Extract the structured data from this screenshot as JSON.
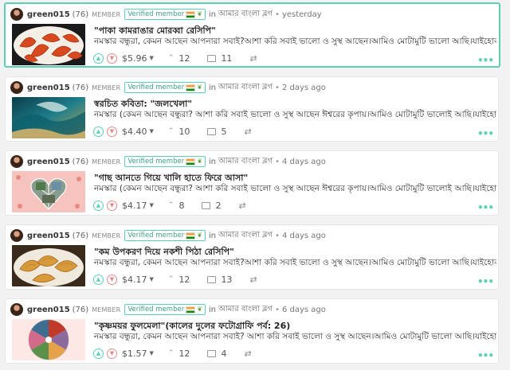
{
  "posts": [
    {
      "author": "green015",
      "reputation": "(76)",
      "role": "MEMBER",
      "badge": "Verified member",
      "in": "in",
      "community": "আমার বাংলা ব্লগ",
      "time": "yesterday",
      "title": "\"পাকা কামরাঙার মোরব্বা রেসিপি\"",
      "excerpt": "নমস্কার বন্ধুরা, কেমন আছেন আপনারা সবাই?আশা করি সবাই ভালো ও সুস্থ আছেন।আমিও মোটামুটি ভালো আছি।যাইহোক আজ চলে আসলাম",
      "payout": "$5.96",
      "votes": "12",
      "comments": "11"
    },
    {
      "author": "green015",
      "reputation": "(76)",
      "role": "MEMBER",
      "badge": "Verified member",
      "in": "in",
      "community": "আমার বাংলা ব্লগ",
      "time": "2 days ago",
      "title": "স্বরচিত কবিতা: \"জলখেলা\"",
      "excerpt": "নমস্কার (কেমন আছেন বন্ধুরা? আশা করি সবাই ভালো ও সুস্থ আছেন ঈশ্বরের কৃপায়।আমিও মোটামুটি ভালোই আছি।যাইহোক আজ চলে",
      "payout": "$4.40",
      "votes": "10",
      "comments": "5"
    },
    {
      "author": "green015",
      "reputation": "(76)",
      "role": "MEMBER",
      "badge": "Verified member",
      "in": "in",
      "community": "আমার বাংলা ব্লগ",
      "time": "4 days ago",
      "title": "\"গাছ আনতে গিয়ে খালি হাতে ফিরে আসা\"",
      "excerpt": "নমস্কার (কেমন আছেন বন্ধুরা? আশা করি সবাই ভালো ও সুস্থ আছেন ঈশ্বরের কৃপায়।আমিও মোটামুটি ভালোই আছি।যাইহোক আজ চলে",
      "payout": "$4.17",
      "votes": "8",
      "comments": "2"
    },
    {
      "author": "green015",
      "reputation": "(76)",
      "role": "MEMBER",
      "badge": "Verified member",
      "in": "in",
      "community": "আমার বাংলা ব্লগ",
      "time": "4 days ago",
      "title": "\"কম উপকরণ দিয়ে নকশী পিঠা রেসিপি\"",
      "excerpt": "নমস্কার বন্ধুরা, কেমন আছেন আপনারা সবাই?আশা করি সবাই ভালো ও সুস্থ আছেন।আমিও মোটামুটি ভালো আছি।যাইহোক আজ চলে আসলাম",
      "payout": "$4.17",
      "votes": "12",
      "comments": "13"
    },
    {
      "author": "green015",
      "reputation": "(76)",
      "role": "MEMBER",
      "badge": "Verified member",
      "in": "in",
      "community": "আমার বাংলা ব্লগ",
      "time": "6 days ago",
      "title": "\"কৃষ্ণময়র ফুলমেলা\"(কালের দুলের ফটোগ্রাফি পর্ব: 26)",
      "excerpt": "নমস্কার বন্ধুরা, কেমন আছেন আপনারা সবাই? আশা করি সবাই ভালো ও সুস্থ আছেন।আমিও মোটামুটি ভালো আছি।যাইহোক আজ আবার",
      "payout": "$1.57",
      "votes": "12",
      "comments": "4"
    }
  ],
  "icons": {
    "upvote": "chevron-up-icon",
    "downvote": "chevron-down-icon",
    "votes": "caret-up-icon",
    "comments": "comment-icon",
    "reblog": "reblog-icon",
    "more": "more-dots-icon"
  },
  "colors": {
    "accent": "#5ad0b5",
    "downvote": "#e28a8a",
    "background": "#f2f2f2"
  }
}
